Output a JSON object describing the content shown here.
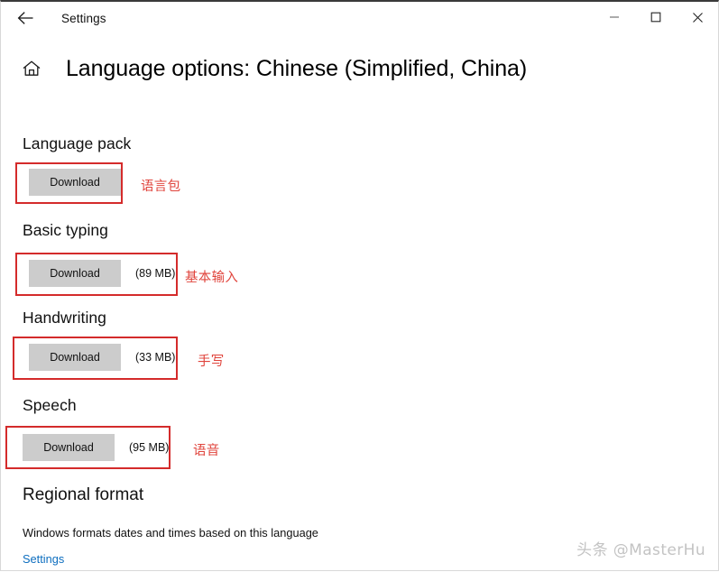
{
  "window": {
    "titlebar": {
      "back_icon": "back-arrow-icon",
      "title": "Settings",
      "minimize_label": "─",
      "maximize_label": "□",
      "close_label": "✕"
    }
  },
  "header": {
    "home_icon": "home-icon",
    "title": "Language options: Chinese (Simplified, China)"
  },
  "sections": [
    {
      "heading": "Language pack",
      "download_label": "Download",
      "size": "",
      "annotation": "语言包"
    },
    {
      "heading": "Basic typing",
      "download_label": "Download",
      "size": "(89 MB)",
      "annotation": "基本输入"
    },
    {
      "heading": "Handwriting",
      "download_label": "Download",
      "size": "(33 MB)",
      "annotation": "手写"
    },
    {
      "heading": "Speech",
      "download_label": "Download",
      "size": "(95 MB)",
      "annotation": "语音"
    }
  ],
  "regional": {
    "heading": "Regional format",
    "description": "Windows formats dates and times based on this language",
    "link_label": "Settings"
  },
  "watermark": {
    "text": "头条 @MasterHu"
  },
  "colors": {
    "annotation_red": "#d42b2b",
    "annotation_text_red": "#e0443c",
    "button_gray": "#cccccc",
    "link_blue": "#0d6ebf"
  }
}
